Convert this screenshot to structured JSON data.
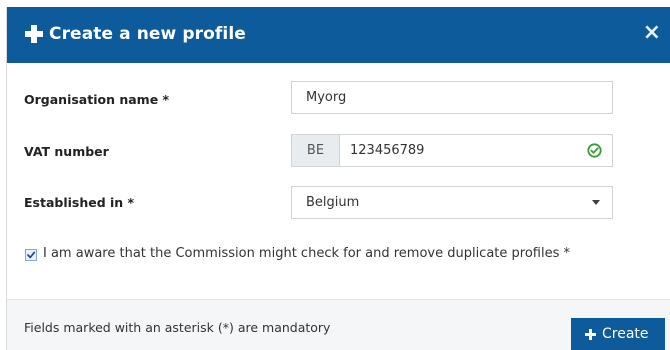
{
  "dialog": {
    "title": "Create a new profile",
    "close_label": "×"
  },
  "form": {
    "organisation": {
      "label": "Organisation name *",
      "value": "Myorg"
    },
    "vat": {
      "label": "VAT number",
      "prefix": "BE",
      "value": "123456789",
      "status_icon": "check-circle-icon"
    },
    "established": {
      "label": "Established in *",
      "value": "Belgium"
    },
    "consent": {
      "label": "I am aware that the Commission might check for and remove duplicate profiles *",
      "checked": true
    }
  },
  "footer": {
    "note": "Fields marked with an asterisk (*) are mandatory",
    "create_label": "Create"
  },
  "colors": {
    "header_bg": "#0e5b9c",
    "valid_green": "#3a9b3a",
    "button_bg": "#0e5b9c"
  }
}
